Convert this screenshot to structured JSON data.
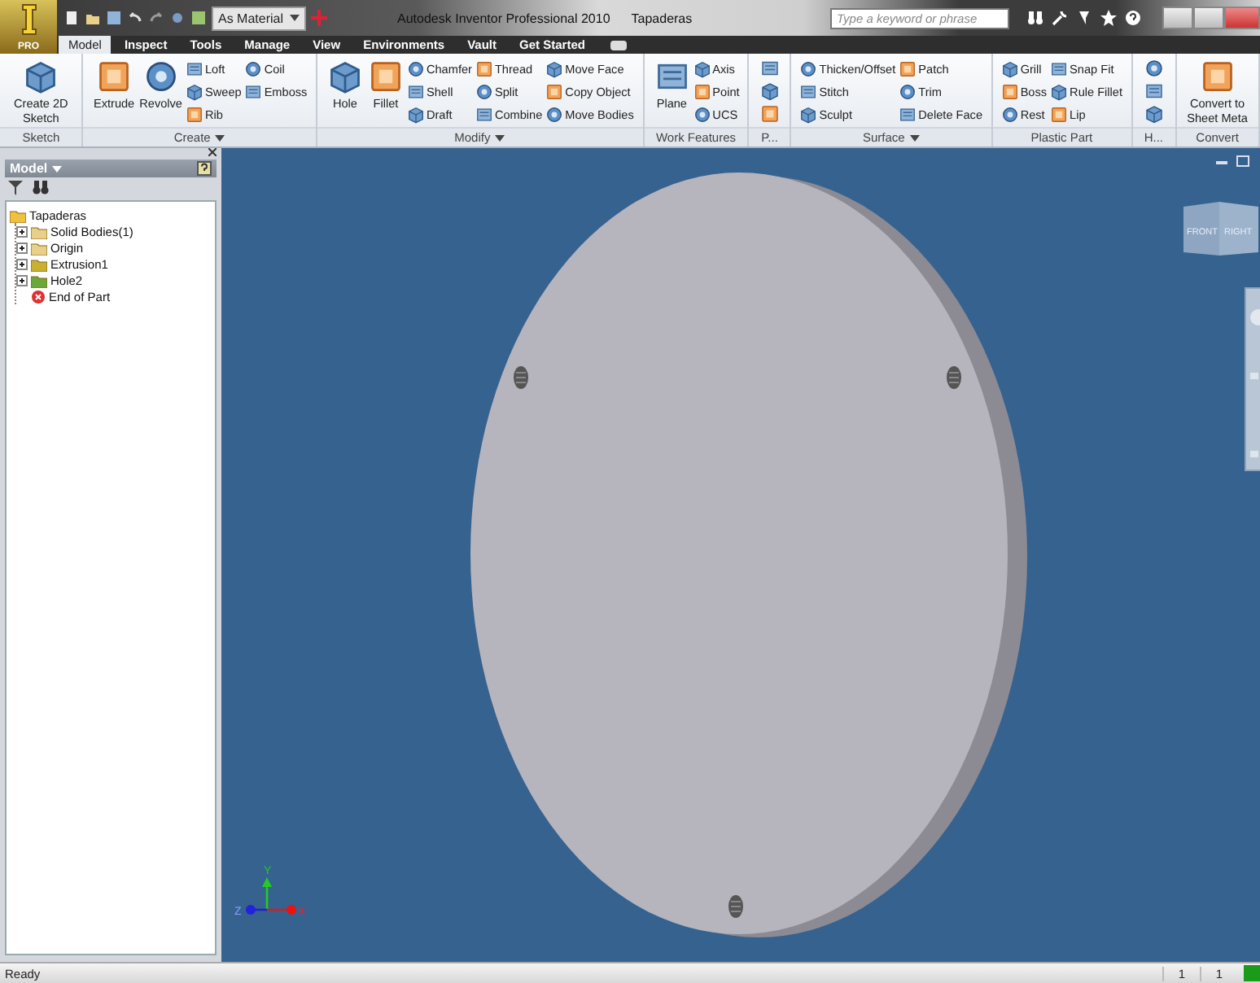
{
  "title_bar": {
    "app_button": "PRO",
    "appearance": "As Material",
    "title": "Autodesk Inventor Professional 2010",
    "document": "Tapaderas",
    "search": {
      "placeholder": "Type a keyword or phrase"
    }
  },
  "tabs": [
    {
      "label": "Model",
      "selected": true
    },
    {
      "label": "Inspect",
      "selected": false
    },
    {
      "label": "Tools",
      "selected": false
    },
    {
      "label": "Manage",
      "selected": false
    },
    {
      "label": "View",
      "selected": false
    },
    {
      "label": "Environments",
      "selected": false
    },
    {
      "label": "Vault",
      "selected": false
    },
    {
      "label": "Get Started",
      "selected": false
    }
  ],
  "ribbon": [
    {
      "label": "Sketch",
      "menu": false,
      "kind": "tools",
      "tools": [
        {
          "label": "Create 2D Sketch",
          "kind": "large"
        }
      ]
    },
    {
      "label": "Create",
      "menu": true,
      "kind": "tools",
      "tools": [
        {
          "label": "Extrude",
          "kind": "large"
        },
        {
          "label": "Revolve",
          "kind": "large"
        },
        {
          "label": "Loft",
          "kind": "small"
        },
        {
          "label": "Sweep",
          "kind": "small"
        },
        {
          "label": "Rib",
          "kind": "small"
        },
        {
          "label": "Coil",
          "kind": "small"
        },
        {
          "label": "Emboss",
          "kind": "small"
        }
      ]
    },
    {
      "label": "Modify",
      "menu": true,
      "kind": "tools",
      "tools": [
        {
          "label": "Hole",
          "kind": "large"
        },
        {
          "label": "Fillet",
          "kind": "large"
        },
        {
          "label": "Chamfer",
          "kind": "small"
        },
        {
          "label": "Shell",
          "kind": "small"
        },
        {
          "label": "Draft",
          "kind": "small"
        },
        {
          "label": "Thread",
          "kind": "small"
        },
        {
          "label": "Split",
          "kind": "small"
        },
        {
          "label": "Combine",
          "kind": "small"
        },
        {
          "label": "Move Face",
          "kind": "small"
        },
        {
          "label": "Copy Object",
          "kind": "small"
        },
        {
          "label": "Move Bodies",
          "kind": "small"
        }
      ]
    },
    {
      "label": "Work Features",
      "menu": false,
      "kind": "tools",
      "tools": [
        {
          "label": "Plane",
          "kind": "large"
        },
        {
          "label": "Axis",
          "kind": "small"
        },
        {
          "label": "Point",
          "kind": "small"
        },
        {
          "label": "UCS",
          "kind": "small"
        }
      ]
    },
    {
      "label": "P...",
      "menu": false,
      "kind": "icons"
    },
    {
      "label": "Surface",
      "menu": true,
      "kind": "tools",
      "tools": [
        {
          "label": "Thicken/Offset",
          "kind": "small"
        },
        {
          "label": "Stitch",
          "kind": "small"
        },
        {
          "label": "Sculpt",
          "kind": "small"
        },
        {
          "label": "Patch",
          "kind": "small"
        },
        {
          "label": "Trim",
          "kind": "small"
        },
        {
          "label": "Delete Face",
          "kind": "small"
        }
      ]
    },
    {
      "label": "Plastic Part",
      "menu": false,
      "kind": "tools",
      "tools": [
        {
          "label": "Grill",
          "kind": "small"
        },
        {
          "label": "Boss",
          "kind": "small"
        },
        {
          "label": "Rest",
          "kind": "small"
        },
        {
          "label": "Snap Fit",
          "kind": "small"
        },
        {
          "label": "Rule Fillet",
          "kind": "small"
        },
        {
          "label": "Lip",
          "kind": "small"
        }
      ]
    },
    {
      "label": "H...",
      "menu": false,
      "kind": "icons"
    },
    {
      "label": "Convert",
      "menu": false,
      "kind": "tools",
      "tools": [
        {
          "label": "Convert to Sheet Meta",
          "kind": "large"
        }
      ]
    }
  ],
  "browser": {
    "title": "Model",
    "tree": [
      {
        "label": "Tapaderas",
        "children": [
          {
            "label": "Solid Bodies(1)",
            "expanded": false
          },
          {
            "label": "Origin",
            "expanded": false
          },
          {
            "label": "Extrusion1",
            "expanded": false
          },
          {
            "label": "Hole2",
            "expanded": false
          },
          {
            "label": "End of Part"
          }
        ]
      }
    ]
  },
  "viewport": {
    "view_cube": [
      "FRONT",
      "RIGHT"
    ],
    "axes": [
      "X",
      "Y",
      "Z"
    ]
  },
  "status_bar": {
    "message": "Ready",
    "fields": [
      "1",
      "1"
    ]
  }
}
